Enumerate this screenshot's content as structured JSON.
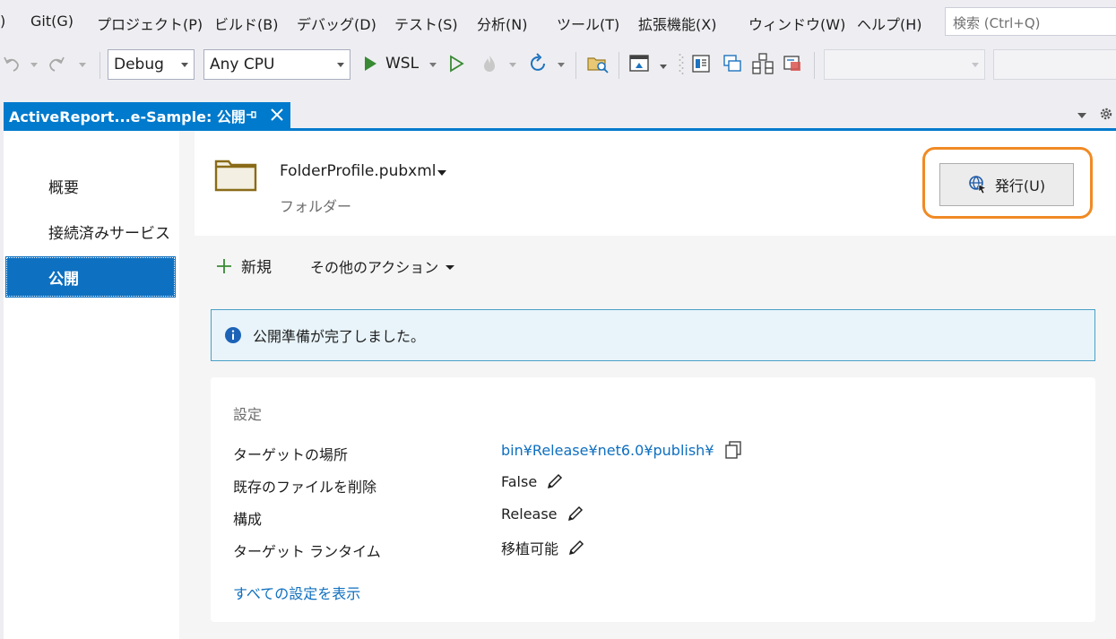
{
  "menubar": {
    "items": [
      {
        "label": ")"
      },
      {
        "label": "Git(G)"
      },
      {
        "label": "プロジェクト(P)"
      },
      {
        "label": "ビルド(B)"
      },
      {
        "label": "デバッグ(D)"
      },
      {
        "label": "テスト(S)"
      },
      {
        "label": "分析(N)"
      },
      {
        "label": "ツール(T)"
      },
      {
        "label": "拡張機能(X)"
      },
      {
        "label": "ウィンドウ(W)"
      },
      {
        "label": "ヘルプ(H)"
      }
    ],
    "search_placeholder": "検索 (Ctrl+Q)"
  },
  "toolbar": {
    "configuration": "Debug",
    "platform": "Any CPU",
    "run_target": "WSL"
  },
  "tab": {
    "title": "ActiveReport...e-Sample: 公開"
  },
  "nav": {
    "items": [
      {
        "label": "概要"
      },
      {
        "label": "接続済みサービス"
      },
      {
        "label": "公開"
      }
    ]
  },
  "profile": {
    "name": "FolderProfile.pubxml",
    "type": "フォルダー",
    "publish_label": "発行(U)"
  },
  "actions": {
    "new_label": "新規",
    "other_label": "その他のアクション"
  },
  "info": {
    "message": "公開準備が完了しました。"
  },
  "settings": {
    "title": "設定",
    "rows": [
      {
        "label": "ターゲットの場所",
        "value": "bin¥Release¥net6.0¥publish¥"
      },
      {
        "label": "既存のファイルを削除",
        "value": "False"
      },
      {
        "label": "構成",
        "value": "Release"
      },
      {
        "label": "ターゲット ランタイム",
        "value": "移植可能"
      }
    ],
    "show_all": "すべての設定を表示"
  },
  "colors": {
    "accent": "#007acc",
    "nav_selected": "#0e70c0",
    "highlight": "#f08a24",
    "link": "#0e6fbf",
    "run_green": "#388a34"
  }
}
